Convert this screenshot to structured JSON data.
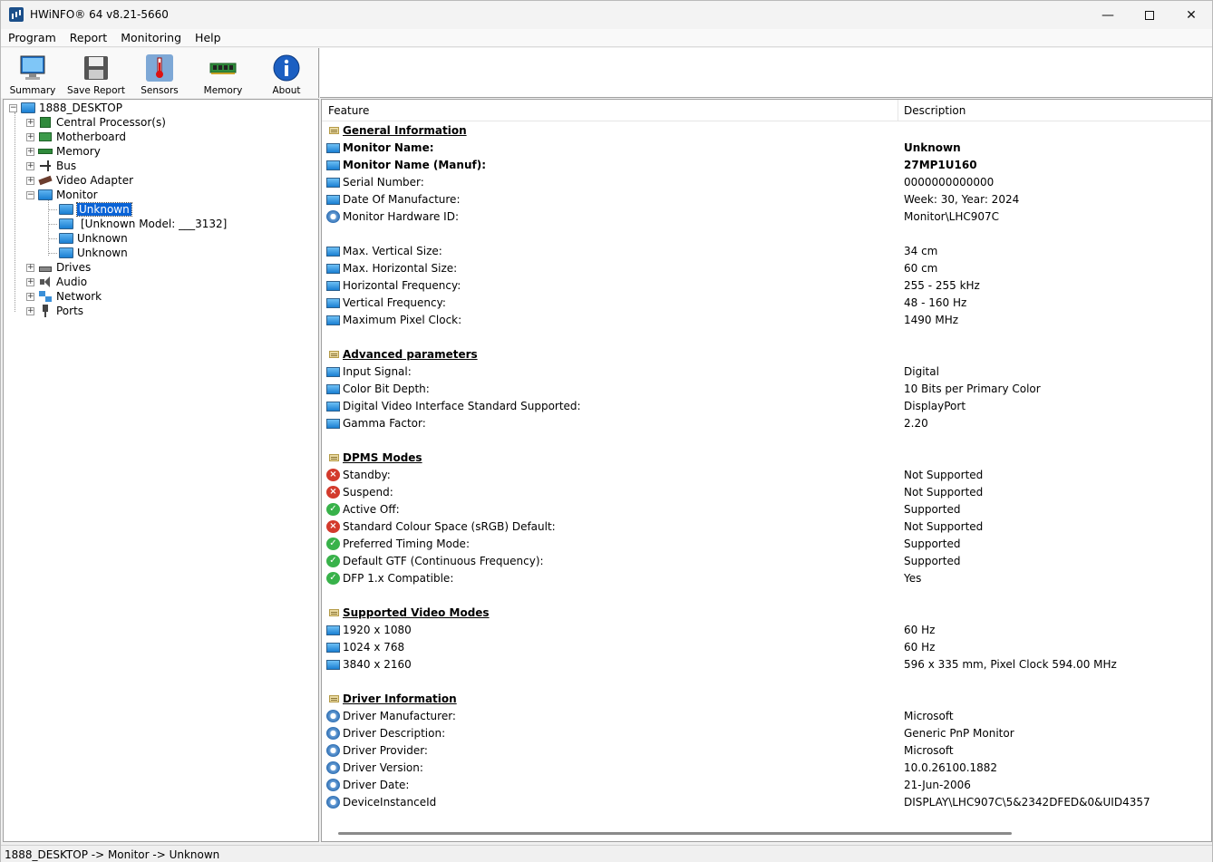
{
  "window": {
    "title": "HWiNFO® 64 v8.21-5660"
  },
  "menu": [
    "Program",
    "Report",
    "Monitoring",
    "Help"
  ],
  "toolbar": [
    {
      "label": "Summary",
      "icon": "monitor-icon"
    },
    {
      "label": "Save Report",
      "icon": "floppy-disk-icon"
    },
    {
      "label": "Sensors",
      "icon": "thermometer-icon"
    },
    {
      "label": "Memory",
      "icon": "memory-module-icon"
    },
    {
      "label": "About",
      "icon": "info-icon"
    }
  ],
  "tree": {
    "root": "1888_DESKTOP",
    "items": [
      {
        "label": "Central Processor(s)",
        "icon": "cpu-icon"
      },
      {
        "label": "Motherboard",
        "icon": "motherboard-icon"
      },
      {
        "label": "Memory",
        "icon": "memory-icon"
      },
      {
        "label": "Bus",
        "icon": "bus-icon"
      },
      {
        "label": "Video Adapter",
        "icon": "video-adapter-icon"
      },
      {
        "label": "Monitor",
        "icon": "monitor-icon"
      },
      {
        "label": "Drives",
        "icon": "drive-icon"
      },
      {
        "label": "Audio",
        "icon": "audio-icon"
      },
      {
        "label": "Network",
        "icon": "network-icon"
      },
      {
        "label": "Ports",
        "icon": "port-icon"
      }
    ],
    "monitor_children": [
      "Unknown",
      "[Unknown Model: ___3132]",
      "Unknown",
      "Unknown"
    ]
  },
  "details": {
    "col_feature": "Feature",
    "col_description": "Description",
    "rows": [
      {
        "type": "section",
        "feature": "General Information",
        "desc": ""
      },
      {
        "type": "bold",
        "icon": "mon",
        "feature": "Monitor Name:",
        "desc": "Unknown"
      },
      {
        "type": "bold",
        "icon": "mon",
        "feature": "Monitor Name (Manuf):",
        "desc": "27MP1U160"
      },
      {
        "type": "row",
        "icon": "mon",
        "feature": "Serial Number:",
        "desc": "0000000000000"
      },
      {
        "type": "row",
        "icon": "mon",
        "feature": "Date Of Manufacture:",
        "desc": "Week: 30, Year: 2024"
      },
      {
        "type": "row",
        "icon": "gear",
        "feature": "Monitor Hardware ID:",
        "desc": "Monitor\\LHC907C"
      },
      {
        "type": "blank"
      },
      {
        "type": "row",
        "icon": "mon",
        "feature": "Max. Vertical Size:",
        "desc": "34 cm"
      },
      {
        "type": "row",
        "icon": "mon",
        "feature": "Max. Horizontal Size:",
        "desc": "60 cm"
      },
      {
        "type": "row",
        "icon": "mon",
        "feature": "Horizontal Frequency:",
        "desc": "255 - 255 kHz"
      },
      {
        "type": "row",
        "icon": "mon",
        "feature": "Vertical Frequency:",
        "desc": "48 - 160 Hz"
      },
      {
        "type": "row",
        "icon": "mon",
        "feature": "Maximum Pixel Clock:",
        "desc": "1490 MHz"
      },
      {
        "type": "blank"
      },
      {
        "type": "section",
        "feature": "Advanced parameters",
        "desc": ""
      },
      {
        "type": "row",
        "icon": "mon",
        "feature": "Input Signal:",
        "desc": "Digital"
      },
      {
        "type": "row",
        "icon": "mon",
        "feature": "Color Bit Depth:",
        "desc": "10 Bits per Primary Color"
      },
      {
        "type": "row",
        "icon": "mon",
        "feature": "Digital Video Interface Standard Supported:",
        "desc": "DisplayPort"
      },
      {
        "type": "row",
        "icon": "mon",
        "feature": "Gamma Factor:",
        "desc": "2.20"
      },
      {
        "type": "blank"
      },
      {
        "type": "section",
        "feature": "DPMS Modes",
        "desc": ""
      },
      {
        "type": "row",
        "icon": "x",
        "feature": "Standby:",
        "desc": "Not Supported"
      },
      {
        "type": "row",
        "icon": "x",
        "feature": "Suspend:",
        "desc": "Not Supported"
      },
      {
        "type": "row",
        "icon": "ok",
        "feature": "Active Off:",
        "desc": "Supported"
      },
      {
        "type": "row",
        "icon": "x",
        "feature": "Standard Colour Space (sRGB) Default:",
        "desc": "Not Supported"
      },
      {
        "type": "row",
        "icon": "ok",
        "feature": "Preferred Timing Mode:",
        "desc": "Supported"
      },
      {
        "type": "row",
        "icon": "ok",
        "feature": "Default GTF (Continuous Frequency):",
        "desc": "Supported"
      },
      {
        "type": "row",
        "icon": "ok",
        "feature": "DFP 1.x Compatible:",
        "desc": "Yes"
      },
      {
        "type": "blank"
      },
      {
        "type": "section",
        "feature": "Supported Video Modes",
        "desc": ""
      },
      {
        "type": "row",
        "icon": "mon",
        "feature": "1920 x 1080",
        "desc": "60 Hz"
      },
      {
        "type": "row",
        "icon": "mon",
        "feature": "1024 x 768",
        "desc": "60 Hz"
      },
      {
        "type": "row",
        "icon": "mon",
        "feature": "3840 x 2160",
        "desc": "596 x 335 mm, Pixel Clock 594.00 MHz"
      },
      {
        "type": "blank"
      },
      {
        "type": "section",
        "feature": "Driver Information",
        "desc": ""
      },
      {
        "type": "row",
        "icon": "gear",
        "feature": "Driver Manufacturer:",
        "desc": "Microsoft"
      },
      {
        "type": "row",
        "icon": "gear",
        "feature": "Driver Description:",
        "desc": "Generic PnP Monitor"
      },
      {
        "type": "row",
        "icon": "gear",
        "feature": "Driver Provider:",
        "desc": "Microsoft"
      },
      {
        "type": "row",
        "icon": "gear",
        "feature": "Driver Version:",
        "desc": "10.0.26100.1882"
      },
      {
        "type": "row",
        "icon": "gear",
        "feature": "Driver Date:",
        "desc": "21-Jun-2006"
      },
      {
        "type": "row",
        "icon": "gear",
        "feature": "DeviceInstanceId",
        "desc": "DISPLAY\\LHC907C\\5&2342DFED&0&UID4357"
      }
    ]
  },
  "status": {
    "path": "1888_DESKTOP -> Monitor -> Unknown"
  },
  "colors": {
    "selection": "#0a63d6",
    "error": "#d33a2c",
    "ok": "#38b24a"
  }
}
